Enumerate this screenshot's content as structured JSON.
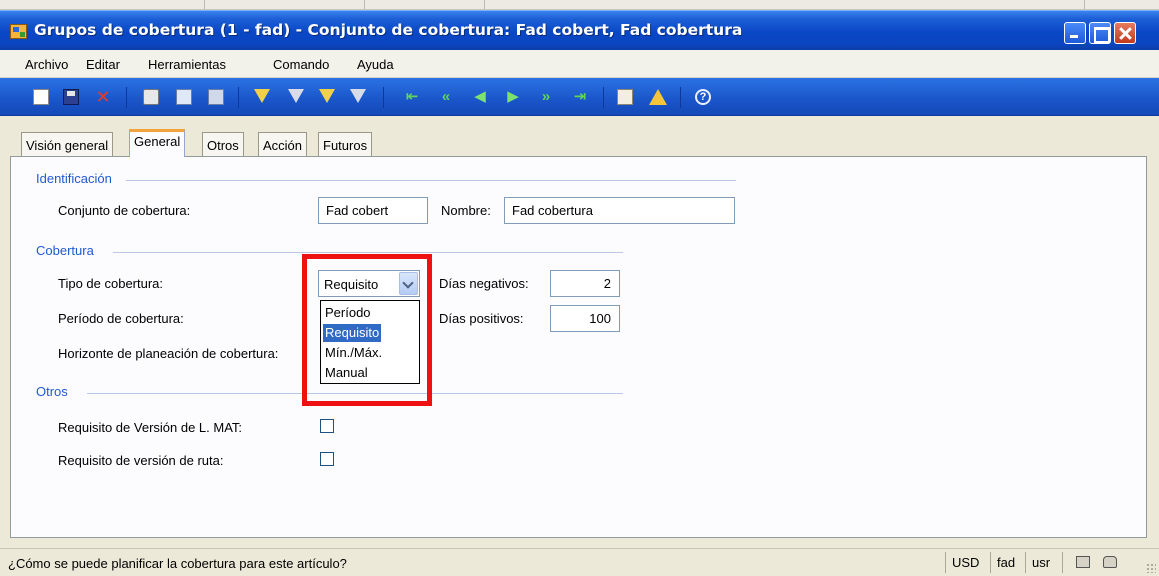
{
  "window": {
    "title": "Grupos de cobertura (1 - fad) - Conjunto de cobertura: Fad cobert, Fad cobertura"
  },
  "menu": [
    "Archivo",
    "Editar",
    "Herramientas",
    "Comando",
    "Ayuda"
  ],
  "tabs": [
    "Visión general",
    "General",
    "Otros",
    "Acción",
    "Futuros"
  ],
  "active_tab": "General",
  "identificacion": {
    "title": "Identificación",
    "conjunto_label": "Conjunto de cobertura:",
    "conjunto_value": "Fad cobert",
    "nombre_label": "Nombre:",
    "nombre_value": "Fad cobertura"
  },
  "cobertura": {
    "title": "Cobertura",
    "tipo_label": "Tipo de cobertura:",
    "tipo_value": "Requisito",
    "periodo_label": "Período de cobertura:",
    "horizonte_label": "Horizonte de planeación de cobertura:",
    "dias_neg_label": "Días negativos:",
    "dias_neg_value": "2",
    "dias_pos_label": "Días positivos:",
    "dias_pos_value": "100",
    "options": [
      "Período",
      "Requisito",
      "Mín./Máx.",
      "Manual"
    ],
    "selected_option": "Requisito"
  },
  "otros": {
    "title": "Otros",
    "lmat_label": "Requisito de Versión de L. MAT:",
    "ruta_label": "Requisito de versión de ruta:",
    "lmat_checked": false,
    "ruta_checked": false
  },
  "status": {
    "help_text": "¿Cómo se puede planificar la cobertura para este artículo?",
    "currency": "USD",
    "company": "fad",
    "user": "usr"
  },
  "colors": {
    "titlebar": "#0a47c6",
    "highlight": "#ee1111",
    "group_title": "#1f5ad0",
    "selection": "#316ac5"
  }
}
